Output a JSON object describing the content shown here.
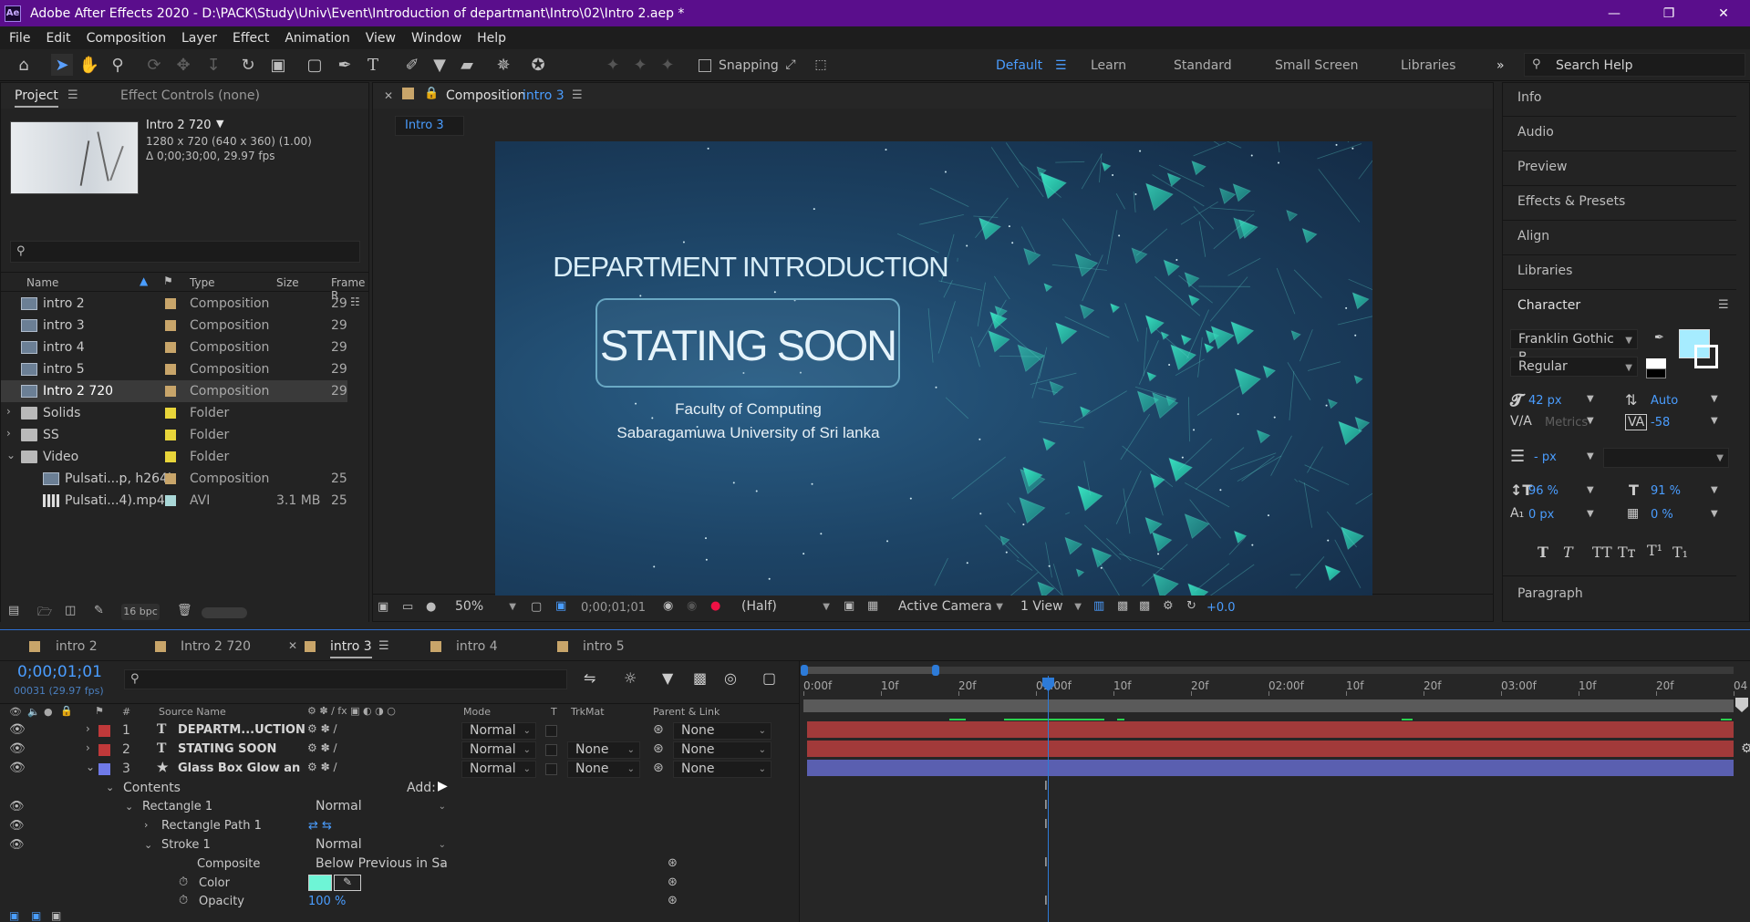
{
  "window": {
    "title": "Adobe After Effects 2020 - D:\\PACK\\Study\\Univ\\Event\\Introduction of departmant\\Intro\\02\\Intro 2.aep *",
    "logo": "Ae"
  },
  "menu": [
    "File",
    "Edit",
    "Composition",
    "Layer",
    "Effect",
    "Animation",
    "View",
    "Window",
    "Help"
  ],
  "toolbar": {
    "snapping_label": "Snapping",
    "workspaces": [
      "Default",
      "Learn",
      "Standard",
      "Small Screen",
      "Libraries"
    ],
    "active_workspace": "Default",
    "search_placeholder": "Search Help"
  },
  "project_panel": {
    "tab_project": "Project",
    "tab_effect_controls": "Effect Controls (none)",
    "selected_name": "Intro 2 720",
    "selected_info_1": "1280 x 720  (640 x 360) (1.00)",
    "selected_info_2": "Δ 0;00;30;00, 29.97 fps",
    "columns": [
      "Name",
      "Type",
      "Size",
      "Frame R"
    ],
    "items": [
      {
        "name": "intro 2",
        "type": "Composition",
        "size": "",
        "frame": "29",
        "label_color": "#c8a56a",
        "kind": "comp"
      },
      {
        "name": "intro 3",
        "type": "Composition",
        "size": "",
        "frame": "29",
        "label_color": "#c8a56a",
        "kind": "comp"
      },
      {
        "name": "intro 4",
        "type": "Composition",
        "size": "",
        "frame": "29",
        "label_color": "#c8a56a",
        "kind": "comp"
      },
      {
        "name": "intro 5",
        "type": "Composition",
        "size": "",
        "frame": "29",
        "label_color": "#c8a56a",
        "kind": "comp"
      },
      {
        "name": "Intro 2 720",
        "type": "Composition",
        "size": "",
        "frame": "29",
        "label_color": "#c8a56a",
        "kind": "comp",
        "selected": true
      },
      {
        "name": "Solids",
        "type": "Folder",
        "size": "",
        "frame": "",
        "label_color": "#e8d53a",
        "kind": "folder"
      },
      {
        "name": "SS",
        "type": "Folder",
        "size": "",
        "frame": "",
        "label_color": "#e8d53a",
        "kind": "folder"
      },
      {
        "name": "Video",
        "type": "Folder",
        "size": "",
        "frame": "",
        "label_color": "#e8d53a",
        "kind": "folder"
      },
      {
        "name": "Pulsati...p, h264)",
        "type": "Composition",
        "size": "",
        "frame": "25",
        "label_color": "#c8a56a",
        "kind": "comp"
      },
      {
        "name": "Pulsati...4).mp4",
        "type": "AVI",
        "size": "3.1 MB",
        "frame": "25",
        "label_color": "#a9d7d7",
        "kind": "footage"
      }
    ],
    "bpc": "16 bpc"
  },
  "composition_panel": {
    "header_prefix": "Composition",
    "header_comp": "intro 3",
    "tab": "Intro 3",
    "heading": "DEPARTMENT INTRODUCTION",
    "main_text": "STATING SOON",
    "sub1": "Faculty of Computing",
    "sub2": "Sabaragamuwa University of Sri lanka",
    "zoom": "50%",
    "timecode": "0;00;01;01",
    "resolution": "(Half)",
    "camera": "Active Camera",
    "views": "1 View",
    "exposure": "+0.0"
  },
  "right_panel": {
    "items": [
      "Info",
      "Audio",
      "Preview",
      "Effects & Presets",
      "Align",
      "Libraries"
    ],
    "character_title": "Character",
    "font": "Franklin Gothic B...",
    "style": "Regular",
    "font_size": "42 px",
    "leading": "Auto",
    "kerning": "Metrics",
    "tracking": "-58",
    "stroke_width": "- px",
    "vscale": "96 %",
    "hscale": "91 %",
    "baseline": "0 px",
    "tsume": "0 %",
    "fill_color": "#a6ecff",
    "paragraph_title": "Paragraph"
  },
  "timeline": {
    "tabs": [
      "intro 2",
      "Intro 2 720",
      "intro 3",
      "intro 4",
      "intro 5"
    ],
    "active_tab": "intro 3",
    "timecode": "0;00;01;01",
    "frames": "00031 (29.97 fps)",
    "columns": {
      "source": "Source Name",
      "mode": "Mode",
      "t": "T",
      "trkmat": "TrkMat",
      "parent": "Parent & Link"
    },
    "layers": [
      {
        "num": "1",
        "name": "DEPARTM...UCTION",
        "mode": "Normal",
        "trkmat": "",
        "parent": "None",
        "color": "#c0393a",
        "bar": "#a23a3a"
      },
      {
        "num": "2",
        "name": "STATING SOON",
        "mode": "Normal",
        "trkmat": "None",
        "parent": "None",
        "color": "#c0393a",
        "bar": "#a23a3a"
      },
      {
        "num": "3",
        "name": "Glass Box Glow an",
        "mode": "Normal",
        "trkmat": "None",
        "parent": "None",
        "color": "#6f7ae8",
        "bar": "#5a5fb0"
      }
    ],
    "contents_label": "Contents",
    "add_label": "Add:",
    "rectangle": "Rectangle 1",
    "rectangle_mode": "Normal",
    "rect_path": "Rectangle Path 1",
    "stroke": "Stroke 1",
    "stroke_mode": "Normal",
    "composite_label": "Composite",
    "composite_value": "Below Previous in Sa",
    "color_label": "Color",
    "opacity_label": "Opacity",
    "opacity_value": "100 %",
    "stroke_color": "#6ef5d6",
    "ruler": [
      "0:00f",
      "10f",
      "20f",
      "01:00f",
      "10f",
      "20f",
      "02:00f",
      "10f",
      "20f",
      "03:00f",
      "10f",
      "20f",
      "04"
    ]
  }
}
